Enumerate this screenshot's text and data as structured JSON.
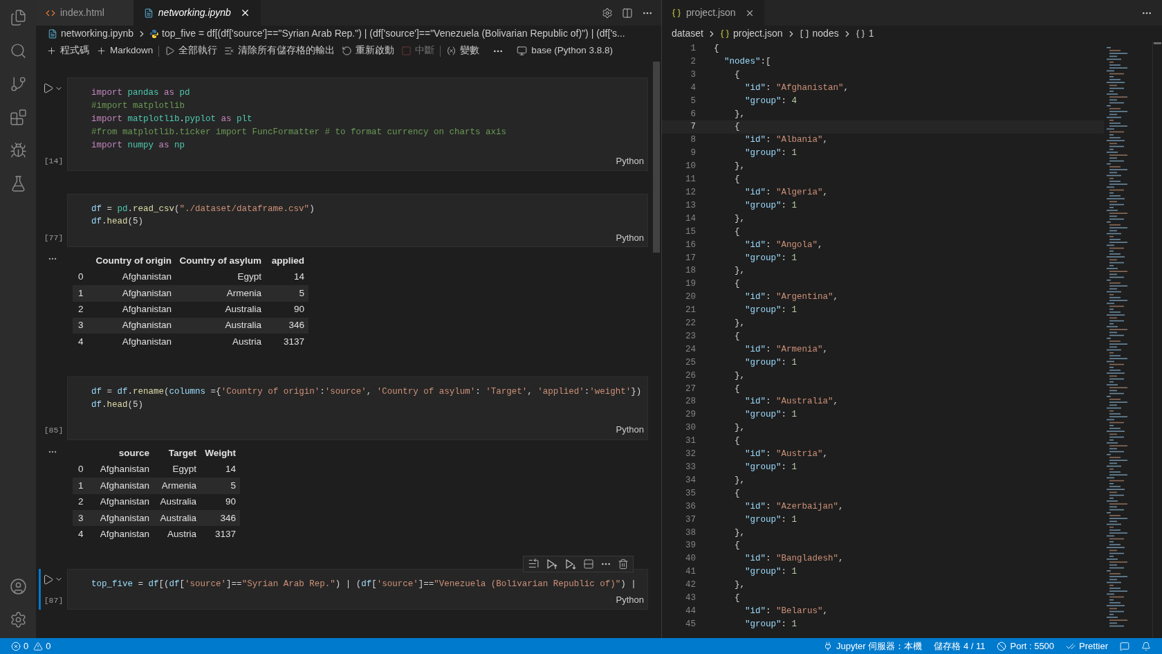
{
  "left_tabs": [
    {
      "label": "index.html",
      "selected": false,
      "preview": false
    },
    {
      "label": "networking.ipynb",
      "selected": true,
      "preview": true
    }
  ],
  "left_breadcrumb": {
    "file": "networking.ipynb",
    "symbol": "top_five = df[(df['source']==\"Syrian Arab Rep.\") | (df['source']==\"Venezuela (Bolivarian Republic of)\") | (df['s..."
  },
  "toolbar": {
    "items": [
      {
        "label": "程式碼",
        "disabled": false
      },
      {
        "label": "Markdown",
        "disabled": false
      },
      {
        "label": "全部執行",
        "disabled": false
      },
      {
        "label": "清除所有儲存格的輸出",
        "disabled": false
      },
      {
        "label": "重新啟動",
        "disabled": false
      },
      {
        "label": "中斷",
        "disabled": true
      },
      {
        "label": "變數",
        "disabled": false
      }
    ],
    "kernel": "base (Python 3.8.8)"
  },
  "cells": [
    {
      "count": "[14]",
      "language": "Python",
      "selected": false,
      "show_run": true,
      "lines": [
        [
          {
            "kind": "kw",
            "text": "import "
          },
          {
            "kind": "mod",
            "text": "pandas "
          },
          {
            "kind": "kw",
            "text": "as "
          },
          {
            "kind": "mod",
            "text": "pd"
          }
        ],
        [
          {
            "kind": "cmt",
            "text": "#import matplotlib"
          }
        ],
        [
          {
            "kind": "kw",
            "text": "import "
          },
          {
            "kind": "mod",
            "text": "matplotlib"
          },
          {
            "kind": "plain",
            "text": "."
          },
          {
            "kind": "mod",
            "text": "pyplot "
          },
          {
            "kind": "kw",
            "text": "as "
          },
          {
            "kind": "mod",
            "text": "plt"
          }
        ],
        [
          {
            "kind": "cmt",
            "text": "#from matplotlib.ticker import FuncFormatter # to format currency on charts axis"
          }
        ],
        [
          {
            "kind": "kw",
            "text": "import "
          },
          {
            "kind": "mod",
            "text": "numpy "
          },
          {
            "kind": "kw",
            "text": "as "
          },
          {
            "kind": "mod",
            "text": "np"
          }
        ]
      ]
    },
    {
      "count": "[77]",
      "language": "Python",
      "selected": false,
      "show_run": false,
      "lines": [
        [
          {
            "kind": "var",
            "text": "df"
          },
          {
            "kind": "plain",
            "text": " = "
          },
          {
            "kind": "mod",
            "text": "pd"
          },
          {
            "kind": "plain",
            "text": "."
          },
          {
            "kind": "fn",
            "text": "read_csv"
          },
          {
            "kind": "plain",
            "text": "("
          },
          {
            "kind": "str",
            "text": "\"./dataset/dataframe.csv\""
          },
          {
            "kind": "plain",
            "text": ")"
          }
        ],
        [
          {
            "kind": "var",
            "text": "df"
          },
          {
            "kind": "plain",
            "text": "."
          },
          {
            "kind": "fn",
            "text": "head"
          },
          {
            "kind": "plain",
            "text": "(5)"
          }
        ]
      ],
      "output": {
        "columns": [
          "Country of origin",
          "Country of asylum",
          "applied"
        ],
        "rows": [
          {
            "index": "0",
            "cells": [
              "Afghanistan",
              "Egypt",
              "14"
            ]
          },
          {
            "index": "1",
            "cells": [
              "Afghanistan",
              "Armenia",
              "5"
            ]
          },
          {
            "index": "2",
            "cells": [
              "Afghanistan",
              "Australia",
              "90"
            ]
          },
          {
            "index": "3",
            "cells": [
              "Afghanistan",
              "Australia",
              "346"
            ]
          },
          {
            "index": "4",
            "cells": [
              "Afghanistan",
              "Austria",
              "3137"
            ]
          }
        ]
      }
    },
    {
      "count": "[85]",
      "language": "Python",
      "selected": false,
      "show_run": false,
      "lines": [
        [
          {
            "kind": "var",
            "text": "df"
          },
          {
            "kind": "plain",
            "text": " = "
          },
          {
            "kind": "var",
            "text": "df"
          },
          {
            "kind": "plain",
            "text": "."
          },
          {
            "kind": "fn",
            "text": "rename"
          },
          {
            "kind": "plain",
            "text": "("
          },
          {
            "kind": "var",
            "text": "columns"
          },
          {
            "kind": "plain",
            "text": " ={"
          },
          {
            "kind": "str",
            "text": "'Country of origin'"
          },
          {
            "kind": "plain",
            "text": ":"
          },
          {
            "kind": "str",
            "text": "'source'"
          },
          {
            "kind": "plain",
            "text": ", "
          },
          {
            "kind": "str",
            "text": "'Country of asylum'"
          },
          {
            "kind": "plain",
            "text": ": "
          },
          {
            "kind": "str",
            "text": "'Target'"
          },
          {
            "kind": "plain",
            "text": ", "
          },
          {
            "kind": "str",
            "text": "'applied'"
          },
          {
            "kind": "plain",
            "text": ":"
          },
          {
            "kind": "str",
            "text": "'weight'"
          },
          {
            "kind": "plain",
            "text": "})"
          }
        ],
        [
          {
            "kind": "var",
            "text": "df"
          },
          {
            "kind": "plain",
            "text": "."
          },
          {
            "kind": "fn",
            "text": "head"
          },
          {
            "kind": "plain",
            "text": "(5)"
          }
        ]
      ],
      "output": {
        "columns": [
          "source",
          "Target",
          "Weight"
        ],
        "rows": [
          {
            "index": "0",
            "cells": [
              "Afghanistan",
              "Egypt",
              "14"
            ]
          },
          {
            "index": "1",
            "cells": [
              "Afghanistan",
              "Armenia",
              "5"
            ]
          },
          {
            "index": "2",
            "cells": [
              "Afghanistan",
              "Australia",
              "90"
            ]
          },
          {
            "index": "3",
            "cells": [
              "Afghanistan",
              "Australia",
              "346"
            ]
          },
          {
            "index": "4",
            "cells": [
              "Afghanistan",
              "Austria",
              "3137"
            ]
          }
        ]
      }
    },
    {
      "count": "[87]",
      "language": "Python",
      "selected": true,
      "show_run": true,
      "lines": [
        [
          {
            "kind": "var",
            "text": "top_five"
          },
          {
            "kind": "plain",
            "text": " = "
          },
          {
            "kind": "var",
            "text": "df"
          },
          {
            "kind": "plain",
            "text": "[("
          },
          {
            "kind": "var",
            "text": "df"
          },
          {
            "kind": "plain",
            "text": "["
          },
          {
            "kind": "str",
            "text": "'source'"
          },
          {
            "kind": "plain",
            "text": "]=="
          },
          {
            "kind": "str",
            "text": "\"Syrian Arab Rep.\""
          },
          {
            "kind": "plain",
            "text": ") | ("
          },
          {
            "kind": "var",
            "text": "df"
          },
          {
            "kind": "plain",
            "text": "["
          },
          {
            "kind": "str",
            "text": "'source'"
          },
          {
            "kind": "plain",
            "text": "]=="
          },
          {
            "kind": "str",
            "text": "\"Venezuela (Bolivarian Republic of)\""
          },
          {
            "kind": "plain",
            "text": ") |"
          }
        ]
      ]
    }
  ],
  "right_tab": {
    "label": "project.json",
    "selected": true
  },
  "right_breadcrumb": [
    "dataset",
    "project.json",
    "nodes",
    "1"
  ],
  "json_lines": [
    {
      "number": "1",
      "current": false,
      "tokens": [
        {
          "kind": "punct",
          "text": "{"
        }
      ]
    },
    {
      "number": "2",
      "current": false,
      "tokens": [
        {
          "kind": "key",
          "text": "  \"nodes\""
        },
        {
          "kind": "punct",
          "text": ":["
        }
      ]
    },
    {
      "number": "3",
      "current": false,
      "tokens": [
        {
          "kind": "punct",
          "text": "    {"
        }
      ]
    },
    {
      "number": "4",
      "current": false,
      "tokens": [
        {
          "kind": "key",
          "text": "      \"id\""
        },
        {
          "kind": "punct",
          "text": ": "
        },
        {
          "kind": "str",
          "text": "\"Afghanistan\""
        },
        {
          "kind": "punct",
          "text": ","
        }
      ]
    },
    {
      "number": "5",
      "current": false,
      "tokens": [
        {
          "kind": "key",
          "text": "      \"group\""
        },
        {
          "kind": "punct",
          "text": ": "
        },
        {
          "kind": "num",
          "text": "4"
        }
      ]
    },
    {
      "number": "6",
      "current": false,
      "tokens": [
        {
          "kind": "punct",
          "text": "    },"
        }
      ]
    },
    {
      "number": "7",
      "current": true,
      "tokens": [
        {
          "kind": "punct",
          "text": "    {"
        }
      ]
    },
    {
      "number": "8",
      "current": false,
      "tokens": [
        {
          "kind": "key",
          "text": "      \"id\""
        },
        {
          "kind": "punct",
          "text": ": "
        },
        {
          "kind": "str",
          "text": "\"Albania\""
        },
        {
          "kind": "punct",
          "text": ","
        }
      ]
    },
    {
      "number": "9",
      "current": false,
      "tokens": [
        {
          "kind": "key",
          "text": "      \"group\""
        },
        {
          "kind": "punct",
          "text": ": "
        },
        {
          "kind": "num",
          "text": "1"
        }
      ]
    },
    {
      "number": "10",
      "current": false,
      "tokens": [
        {
          "kind": "punct",
          "text": "    },"
        }
      ]
    },
    {
      "number": "11",
      "current": false,
      "tokens": [
        {
          "kind": "punct",
          "text": "    {"
        }
      ]
    },
    {
      "number": "12",
      "current": false,
      "tokens": [
        {
          "kind": "key",
          "text": "      \"id\""
        },
        {
          "kind": "punct",
          "text": ": "
        },
        {
          "kind": "str",
          "text": "\"Algeria\""
        },
        {
          "kind": "punct",
          "text": ","
        }
      ]
    },
    {
      "number": "13",
      "current": false,
      "tokens": [
        {
          "kind": "key",
          "text": "      \"group\""
        },
        {
          "kind": "punct",
          "text": ": "
        },
        {
          "kind": "num",
          "text": "1"
        }
      ]
    },
    {
      "number": "14",
      "current": false,
      "tokens": [
        {
          "kind": "punct",
          "text": "    },"
        }
      ]
    },
    {
      "number": "15",
      "current": false,
      "tokens": [
        {
          "kind": "punct",
          "text": "    {"
        }
      ]
    },
    {
      "number": "16",
      "current": false,
      "tokens": [
        {
          "kind": "key",
          "text": "      \"id\""
        },
        {
          "kind": "punct",
          "text": ": "
        },
        {
          "kind": "str",
          "text": "\"Angola\""
        },
        {
          "kind": "punct",
          "text": ","
        }
      ]
    },
    {
      "number": "17",
      "current": false,
      "tokens": [
        {
          "kind": "key",
          "text": "      \"group\""
        },
        {
          "kind": "punct",
          "text": ": "
        },
        {
          "kind": "num",
          "text": "1"
        }
      ]
    },
    {
      "number": "18",
      "current": false,
      "tokens": [
        {
          "kind": "punct",
          "text": "    },"
        }
      ]
    },
    {
      "number": "19",
      "current": false,
      "tokens": [
        {
          "kind": "punct",
          "text": "    {"
        }
      ]
    },
    {
      "number": "20",
      "current": false,
      "tokens": [
        {
          "kind": "key",
          "text": "      \"id\""
        },
        {
          "kind": "punct",
          "text": ": "
        },
        {
          "kind": "str",
          "text": "\"Argentina\""
        },
        {
          "kind": "punct",
          "text": ","
        }
      ]
    },
    {
      "number": "21",
      "current": false,
      "tokens": [
        {
          "kind": "key",
          "text": "      \"group\""
        },
        {
          "kind": "punct",
          "text": ": "
        },
        {
          "kind": "num",
          "text": "1"
        }
      ]
    },
    {
      "number": "22",
      "current": false,
      "tokens": [
        {
          "kind": "punct",
          "text": "    },"
        }
      ]
    },
    {
      "number": "23",
      "current": false,
      "tokens": [
        {
          "kind": "punct",
          "text": "    {"
        }
      ]
    },
    {
      "number": "24",
      "current": false,
      "tokens": [
        {
          "kind": "key",
          "text": "      \"id\""
        },
        {
          "kind": "punct",
          "text": ": "
        },
        {
          "kind": "str",
          "text": "\"Armenia\""
        },
        {
          "kind": "punct",
          "text": ","
        }
      ]
    },
    {
      "number": "25",
      "current": false,
      "tokens": [
        {
          "kind": "key",
          "text": "      \"group\""
        },
        {
          "kind": "punct",
          "text": ": "
        },
        {
          "kind": "num",
          "text": "1"
        }
      ]
    },
    {
      "number": "26",
      "current": false,
      "tokens": [
        {
          "kind": "punct",
          "text": "    },"
        }
      ]
    },
    {
      "number": "27",
      "current": false,
      "tokens": [
        {
          "kind": "punct",
          "text": "    {"
        }
      ]
    },
    {
      "number": "28",
      "current": false,
      "tokens": [
        {
          "kind": "key",
          "text": "      \"id\""
        },
        {
          "kind": "punct",
          "text": ": "
        },
        {
          "kind": "str",
          "text": "\"Australia\""
        },
        {
          "kind": "punct",
          "text": ","
        }
      ]
    },
    {
      "number": "29",
      "current": false,
      "tokens": [
        {
          "kind": "key",
          "text": "      \"group\""
        },
        {
          "kind": "punct",
          "text": ": "
        },
        {
          "kind": "num",
          "text": "1"
        }
      ]
    },
    {
      "number": "30",
      "current": false,
      "tokens": [
        {
          "kind": "punct",
          "text": "    },"
        }
      ]
    },
    {
      "number": "31",
      "current": false,
      "tokens": [
        {
          "kind": "punct",
          "text": "    {"
        }
      ]
    },
    {
      "number": "32",
      "current": false,
      "tokens": [
        {
          "kind": "key",
          "text": "      \"id\""
        },
        {
          "kind": "punct",
          "text": ": "
        },
        {
          "kind": "str",
          "text": "\"Austria\""
        },
        {
          "kind": "punct",
          "text": ","
        }
      ]
    },
    {
      "number": "33",
      "current": false,
      "tokens": [
        {
          "kind": "key",
          "text": "      \"group\""
        },
        {
          "kind": "punct",
          "text": ": "
        },
        {
          "kind": "num",
          "text": "1"
        }
      ]
    },
    {
      "number": "34",
      "current": false,
      "tokens": [
        {
          "kind": "punct",
          "text": "    },"
        }
      ]
    },
    {
      "number": "35",
      "current": false,
      "tokens": [
        {
          "kind": "punct",
          "text": "    {"
        }
      ]
    },
    {
      "number": "36",
      "current": false,
      "tokens": [
        {
          "kind": "key",
          "text": "      \"id\""
        },
        {
          "kind": "punct",
          "text": ": "
        },
        {
          "kind": "str",
          "text": "\"Azerbaijan\""
        },
        {
          "kind": "punct",
          "text": ","
        }
      ]
    },
    {
      "number": "37",
      "current": false,
      "tokens": [
        {
          "kind": "key",
          "text": "      \"group\""
        },
        {
          "kind": "punct",
          "text": ": "
        },
        {
          "kind": "num",
          "text": "1"
        }
      ]
    },
    {
      "number": "38",
      "current": false,
      "tokens": [
        {
          "kind": "punct",
          "text": "    },"
        }
      ]
    },
    {
      "number": "39",
      "current": false,
      "tokens": [
        {
          "kind": "punct",
          "text": "    {"
        }
      ]
    },
    {
      "number": "40",
      "current": false,
      "tokens": [
        {
          "kind": "key",
          "text": "      \"id\""
        },
        {
          "kind": "punct",
          "text": ": "
        },
        {
          "kind": "str",
          "text": "\"Bangladesh\""
        },
        {
          "kind": "punct",
          "text": ","
        }
      ]
    },
    {
      "number": "41",
      "current": false,
      "tokens": [
        {
          "kind": "key",
          "text": "      \"group\""
        },
        {
          "kind": "punct",
          "text": ": "
        },
        {
          "kind": "num",
          "text": "1"
        }
      ]
    },
    {
      "number": "42",
      "current": false,
      "tokens": [
        {
          "kind": "punct",
          "text": "    },"
        }
      ]
    },
    {
      "number": "43",
      "current": false,
      "tokens": [
        {
          "kind": "punct",
          "text": "    {"
        }
      ]
    },
    {
      "number": "44",
      "current": false,
      "tokens": [
        {
          "kind": "key",
          "text": "      \"id\""
        },
        {
          "kind": "punct",
          "text": ": "
        },
        {
          "kind": "str",
          "text": "\"Belarus\""
        },
        {
          "kind": "punct",
          "text": ","
        }
      ]
    },
    {
      "number": "45",
      "current": false,
      "tokens": [
        {
          "kind": "key",
          "text": "      \"group\""
        },
        {
          "kind": "punct",
          "text": ": "
        },
        {
          "kind": "num",
          "text": "1"
        }
      ]
    }
  ],
  "status_bar": {
    "errors": "0",
    "warnings": "0",
    "items": [
      "Jupyter 伺服器：本機",
      "儲存格 4 / 11",
      "Port : 5500",
      "Prettier"
    ]
  }
}
